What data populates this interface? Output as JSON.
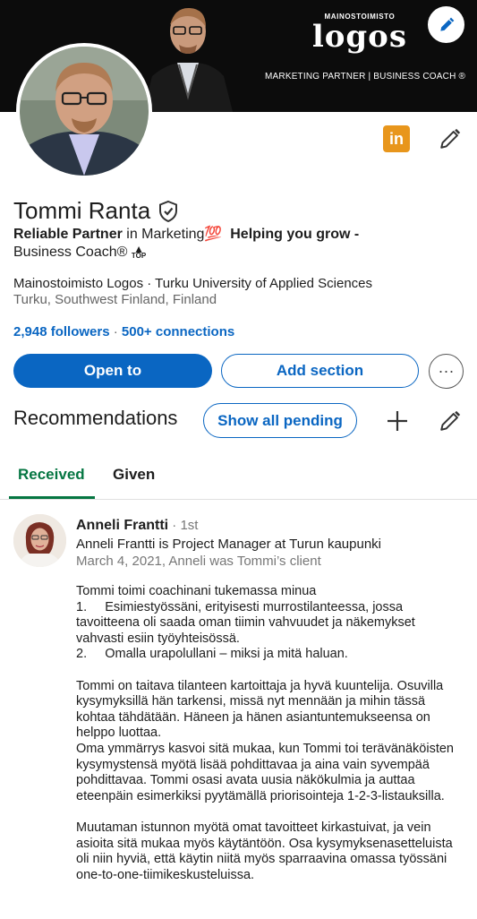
{
  "banner": {
    "brand_top": "MAINOSTOIMISTO",
    "brand_main": "logos",
    "tagline": "MARKETING PARTNER  |  BUSINESS COACH ®"
  },
  "profile": {
    "name": "Tommi Ranta",
    "headline_bold_1": "Reliable Partner",
    "headline_text_1": " in Marketing",
    "headline_emoji": "💯",
    "headline_bold_2": "Helping you grow -",
    "headline_text_2": "Business Coach®",
    "top_glyph": "TOP",
    "company_line": "Mainostoimisto Logos · Turku University of Applied Sciences",
    "location": "Turku, Southwest Finland, Finland",
    "followers": "2,948 followers",
    "separator": " · ",
    "connections": "500+ connections",
    "linkedin_icon_text": "in"
  },
  "actions": {
    "open_to": "Open to",
    "add_section": "Add section",
    "more": "···"
  },
  "recommendations": {
    "title": "Recommendations",
    "show_pending": "Show all pending",
    "tabs": [
      {
        "label": "Received",
        "active": true
      },
      {
        "label": "Given",
        "active": false
      }
    ],
    "item": {
      "name": "Anneli Frantti",
      "degree": " · 1st",
      "role": "Anneli Frantti is Project Manager at Turun kaupunki",
      "date": "March 4, 2021, Anneli was Tommi’s client",
      "body": [
        "Tommi toimi coachinani tukemassa minua",
        "1.     Esimiestyössäni, erityisesti murrostilanteessa, jossa tavoitteena oli saada oman tiimin vahvuudet ja näkemykset vahvasti esiin työyhteisössä.",
        "2.     Omalla urapolullani – miksi ja mitä haluan.",
        "",
        "Tommi on taitava tilanteen kartoittaja ja hyvä kuuntelija. Osuvilla kysymyksillä hän tarkensi, missä nyt mennään ja mihin tässä kohtaa tähdätään. Häneen ja hänen asiantuntemukseensa on helppo luottaa.",
        "Oma ymmärrys kasvoi sitä mukaa, kun Tommi toi terävänäköisten kysymystensä myötä lisää pohdittavaa ja aina vain syvempää pohdittavaa. Tommi osasi avata uusia näkökulmia ja auttaa eteenpäin esimerkiksi pyytämällä priorisointeja 1-2-3-listauksilla.",
        "",
        "Muutaman istunnon myötä omat tavoitteet kirkastuivat, ja vein asioita sitä mukaa myös käytäntöön. Osa kysymyksenasetteluista oli niin hyviä, että käytin niitä myös sparraavina omassa työssäni one-to-one-tiimikeskusteluissa."
      ]
    }
  },
  "colors": {
    "accent": "#0a66c2",
    "tab_active": "#057642",
    "linkedin_icon": "#e8961c"
  },
  "icons": [
    "pencil-icon",
    "linkedin-icon",
    "verified-shield-icon",
    "plus-icon",
    "more-icon",
    "top-arrow-icon"
  ]
}
